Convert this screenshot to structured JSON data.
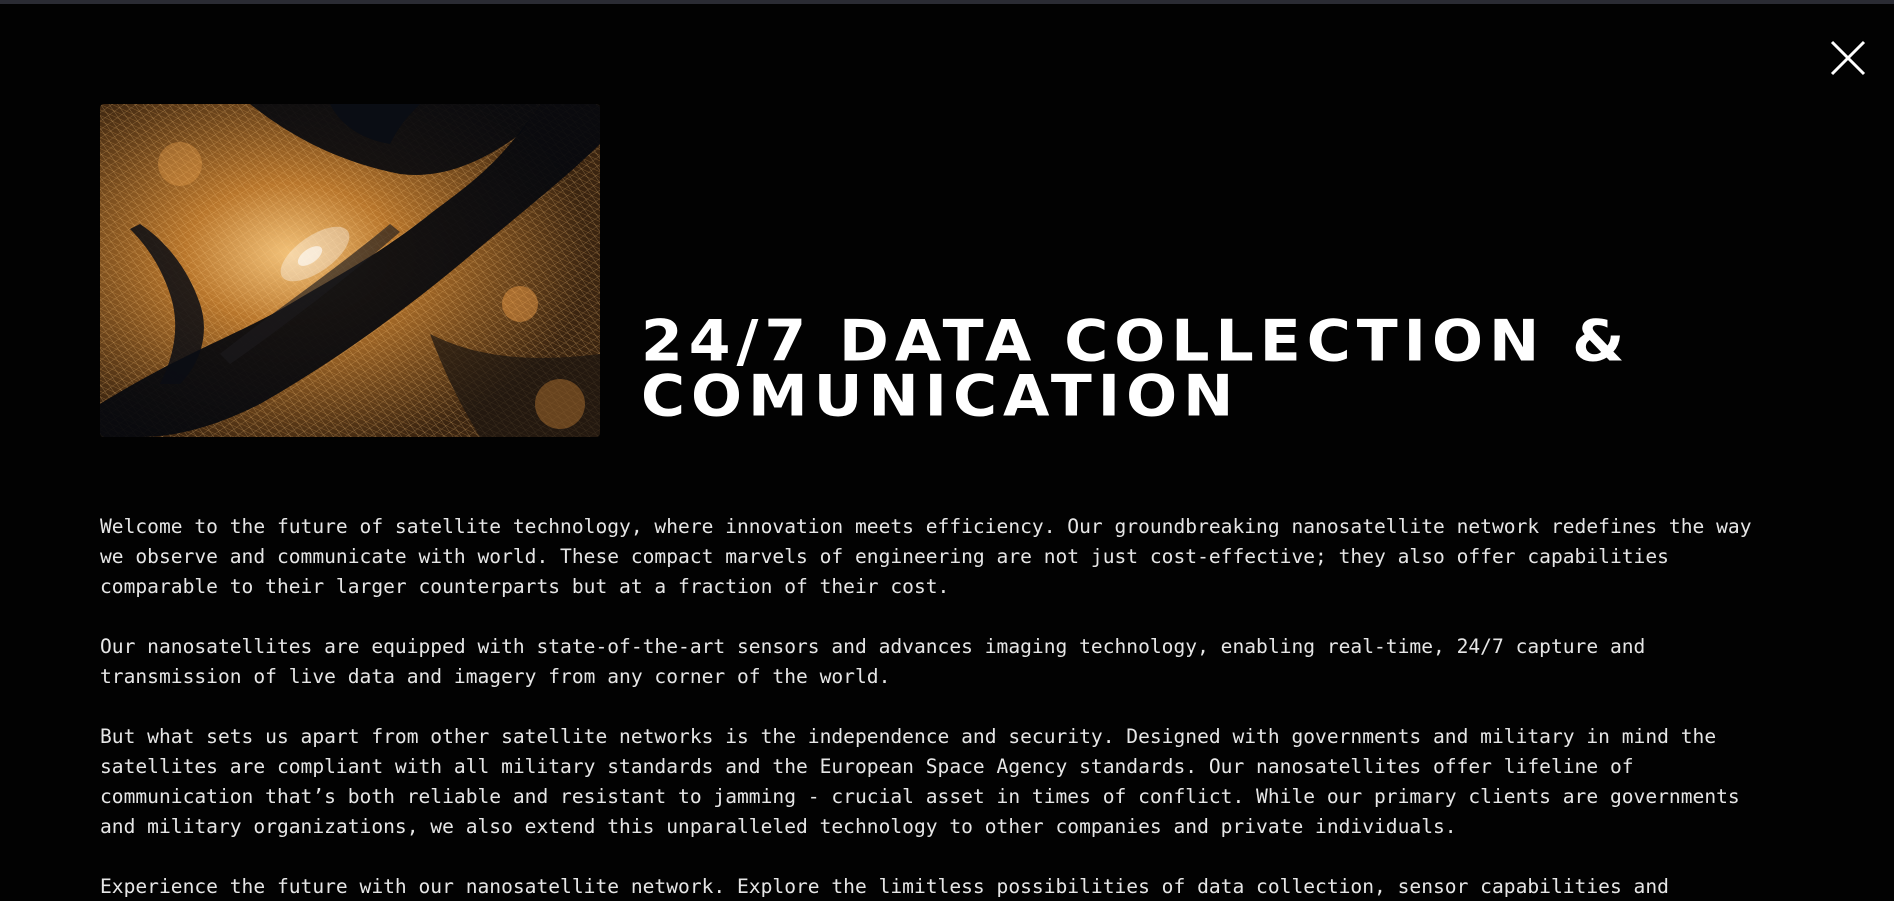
{
  "modal": {
    "close_icon": "close-icon",
    "image_alt": "Satellite night view of a city",
    "title_line1": "24/7 DATA COLLECTION &",
    "title_line2": "COMUNICATION",
    "paragraphs": [
      [
        "Welcome to the future of satellite technology, where innovation meets efficiency. Our groundbreaking nanosatellite network redefines the way",
        "we observe and communicate with world. These compact marvels of engineering are not just cost-effective; they also offer capabilities",
        "comparable to their larger counterparts but at a fraction of their cost."
      ],
      [
        "Our nanosatellites are equipped with state-of-the-art sensors and advances imaging technology, enabling real-time, 24/7 capture and",
        "transmission of live data and imagery from any corner of the world."
      ],
      [
        "But what sets us apart from other satellite networks is the independence and security. Designed with governments and military in mind the",
        "satellites are compliant with all military standards and the European Space Agency standards. Our nanosatellites offer lifeline of",
        "communication that’s both reliable and resistant to jamming - crucial asset in times of conflict. While our primary clients are governments",
        "and military organizations, we also extend this unparalleled technology to other companies and private individuals."
      ],
      [
        "Experience the future with our nanosatellite network. Explore the limitless possibilities of data collection, sensor capabilities and"
      ]
    ]
  },
  "colors": {
    "background": "#020202",
    "text": "#e6e6e6",
    "title": "#ffffff",
    "city_lights": "#d89a45",
    "water": "#0a0d14"
  }
}
